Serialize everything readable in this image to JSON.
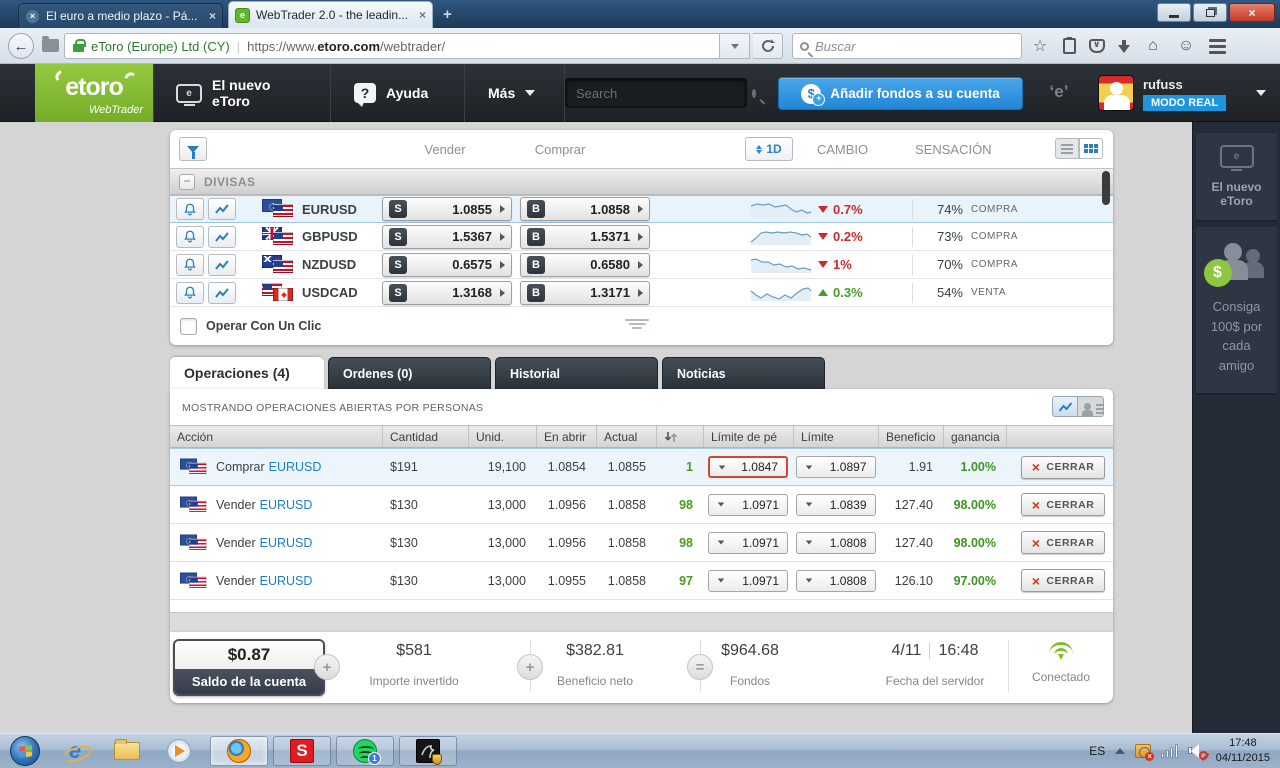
{
  "colors": {
    "accent_blue": "#2187d6",
    "brand_green": "#82b829",
    "positive": "#3e9420",
    "negative": "#cc2b2b",
    "mode_badge_blue": "#1d96e0"
  },
  "browser": {
    "tab_inactive": "El euro a medio plazo - Pá...",
    "tab_active": "WebTrader 2.0 - the leadin...",
    "identity": "eToro (Europe) Ltd (CY)",
    "url_pre": "https://www.",
    "url_domain": "etoro.com",
    "url_path": "/webtrader/",
    "search_placeholder": "Buscar"
  },
  "header": {
    "logo": "etoro",
    "logo_sub": "WebTrader",
    "nav_new": "El nuevo eToro",
    "nav_help": "Ayuda",
    "nav_more": "Más",
    "search_placeholder": "Search",
    "add_funds": "Añadir fondos a su cuenta",
    "username": "rufuss",
    "mode": "MODO REAL"
  },
  "market": {
    "sell_header": "Vender",
    "buy_header": "Comprar",
    "period": "1D",
    "change_header": "CAMBIO",
    "sentiment_header": "SENSACIÓN",
    "group": "DIVISAS",
    "one_click": "Operar Con Un Clic",
    "rows": [
      {
        "symbol": "EURUSD",
        "sell": "1.0855",
        "buy": "1.0858",
        "change": "0.7%",
        "direction": "down",
        "sentiment_pct": "74%",
        "sentiment": "COMPRA",
        "spark": [
          [
            1,
            6
          ],
          [
            7,
            4
          ],
          [
            13,
            5
          ],
          [
            19,
            4
          ],
          [
            25,
            7
          ],
          [
            31,
            6
          ],
          [
            36,
            5
          ],
          [
            41,
            9
          ],
          [
            46,
            12
          ],
          [
            52,
            10
          ],
          [
            57,
            13
          ],
          [
            61,
            12
          ]
        ]
      },
      {
        "symbol": "GBPUSD",
        "sell": "1.5367",
        "buy": "1.5371",
        "change": "0.2%",
        "direction": "down",
        "sentiment_pct": "73%",
        "sentiment": "COMPRA",
        "spark": [
          [
            1,
            14
          ],
          [
            6,
            10
          ],
          [
            11,
            5
          ],
          [
            16,
            4
          ],
          [
            22,
            5
          ],
          [
            28,
            4
          ],
          [
            34,
            5
          ],
          [
            40,
            4
          ],
          [
            46,
            5
          ],
          [
            52,
            7
          ],
          [
            57,
            6
          ],
          [
            61,
            9
          ]
        ]
      },
      {
        "symbol": "NZDUSD",
        "sell": "0.6575",
        "buy": "0.6580",
        "change": "1%",
        "direction": "down",
        "sentiment_pct": "70%",
        "sentiment": "COMPRA",
        "spark": [
          [
            1,
            4
          ],
          [
            6,
            3
          ],
          [
            12,
            6
          ],
          [
            18,
            6
          ],
          [
            24,
            9
          ],
          [
            30,
            8
          ],
          [
            36,
            11
          ],
          [
            42,
            10
          ],
          [
            48,
            13
          ],
          [
            54,
            12
          ],
          [
            61,
            14
          ]
        ]
      },
      {
        "symbol": "USDCAD",
        "sell": "1.3168",
        "buy": "1.3171",
        "change": "0.3%",
        "direction": "up",
        "sentiment_pct": "54%",
        "sentiment": "VENTA",
        "spark": [
          [
            1,
            7
          ],
          [
            6,
            11
          ],
          [
            11,
            14
          ],
          [
            17,
            10
          ],
          [
            23,
            13
          ],
          [
            29,
            15
          ],
          [
            35,
            11
          ],
          [
            41,
            14
          ],
          [
            47,
            9
          ],
          [
            53,
            5
          ],
          [
            58,
            4
          ],
          [
            61,
            7
          ]
        ]
      }
    ]
  },
  "tabs": {
    "operations": "Operaciones (4)",
    "orders": "Ordenes (0)",
    "history": "Historial",
    "news": "Noticias"
  },
  "operations": {
    "showing": "MOSTRANDO OPERACIONES ABIERTAS POR PERSONAS",
    "h_action": "Acción",
    "h_amount": "Cantidad",
    "h_units": "Unid.",
    "h_open": "En abrir",
    "h_current": "Actual",
    "h_sl": "Límite de pé",
    "h_tp": "Límite",
    "h_profit": "Beneficio",
    "h_gain": "ganancia",
    "rows": [
      {
        "action": "Comprar",
        "symbol": "EURUSD",
        "amount": "$191",
        "units": "19,100",
        "open": "1.0854",
        "current": "1.0855",
        "pips": "1",
        "sl": "1.0847",
        "tp": "1.0897",
        "profit": "1.91",
        "gain": "1.00%",
        "close": "CERRAR"
      },
      {
        "action": "Vender",
        "symbol": "EURUSD",
        "amount": "$130",
        "units": "13,000",
        "open": "1.0956",
        "current": "1.0858",
        "pips": "98",
        "sl": "1.0971",
        "tp": "1.0839",
        "profit": "127.40",
        "gain": "98.00%",
        "close": "CERRAR"
      },
      {
        "action": "Vender",
        "symbol": "EURUSD",
        "amount": "$130",
        "units": "13,000",
        "open": "1.0956",
        "current": "1.0858",
        "pips": "98",
        "sl": "1.0971",
        "tp": "1.0808",
        "profit": "127.40",
        "gain": "98.00%",
        "close": "CERRAR"
      },
      {
        "action": "Vender",
        "symbol": "EURUSD",
        "amount": "$130",
        "units": "13,000",
        "open": "1.0955",
        "current": "1.0858",
        "pips": "97",
        "sl": "1.0971",
        "tp": "1.0808",
        "profit": "126.10",
        "gain": "97.00%",
        "close": "CERRAR"
      }
    ]
  },
  "summary": {
    "balance": "$0.87",
    "balance_label": "Saldo de la cuenta",
    "invested": "$581",
    "invested_label": "Importe invertido",
    "net_profit": "$382.81",
    "net_profit_label": "Beneficio neto",
    "equity": "$964.68",
    "equity_label": "Fondos",
    "date": "4/11",
    "time": "16:48",
    "server_label": "Fecha del servidor",
    "connected": "Conectado"
  },
  "sidebar": {
    "new_etoro": "El nuevo eToro",
    "referral": "Consiga 100$ por cada amigo"
  },
  "taskbar": {
    "lang": "ES",
    "time": "17:48",
    "date": "04/11/2015"
  }
}
